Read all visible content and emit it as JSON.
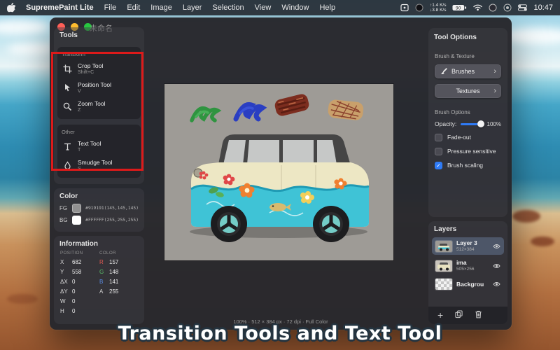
{
  "menubar": {
    "app_name": "SupremePaint Lite",
    "menus": [
      "File",
      "Edit",
      "Image",
      "Layer",
      "Selection",
      "View",
      "Window",
      "Help"
    ],
    "status": {
      "net_up": "↑1.4 K/s",
      "net_down": "↓3.8 K/s",
      "battery_level": "90",
      "time": "10:47"
    }
  },
  "window": {
    "title": "未命名",
    "tools": {
      "title": "Tools",
      "transform_label": "Transform",
      "other_label": "Other",
      "items": [
        {
          "name": "Crop Tool",
          "shortcut": "Shift+C"
        },
        {
          "name": "Position Tool",
          "shortcut": "V"
        },
        {
          "name": "Zoom Tool",
          "shortcut": "Z"
        },
        {
          "name": "Text Tool",
          "shortcut": "T"
        },
        {
          "name": "Smudge Tool",
          "shortcut": "S"
        }
      ]
    },
    "color": {
      "title": "Color",
      "fg_label": "FG",
      "fg_value": "#919191(145,145,145)",
      "fg_hex": "#919191",
      "bg_label": "BG",
      "bg_value": "#FFFFFF(255,255,255)",
      "bg_hex": "#FFFFFF"
    },
    "info": {
      "title": "Information",
      "position_header": "POSITION",
      "color_header": "COLOR",
      "rows": [
        {
          "pl": "X",
          "pv": "682",
          "cl": "R",
          "cv": "157"
        },
        {
          "pl": "Y",
          "pv": "558",
          "cl": "G",
          "cv": "148"
        },
        {
          "pl": "ΔX",
          "pv": "0",
          "cl": "B",
          "cv": "141"
        },
        {
          "pl": "ΔY",
          "pv": "0",
          "cl": "A",
          "cv": "255"
        },
        {
          "pl": "W",
          "pv": "0",
          "cl": "",
          "cv": ""
        },
        {
          "pl": "H",
          "pv": "0",
          "cl": "",
          "cv": ""
        }
      ]
    },
    "tool_options": {
      "title": "Tool Options",
      "brush_texture_label": "Brush & Texture",
      "brushes_button": "Brushes",
      "textures_button": "Textures",
      "brush_options_label": "Brush Options",
      "opacity_label": "Opacity:",
      "opacity_value": "100%",
      "checkboxes": [
        {
          "label": "Fade-out",
          "checked": false
        },
        {
          "label": "Pressure sensitive",
          "checked": false
        },
        {
          "label": "Brush scaling",
          "checked": true
        }
      ]
    },
    "layers": {
      "title": "Layers",
      "items": [
        {
          "name": "Layer 3",
          "size": "512×384"
        },
        {
          "name": "ima",
          "size": "505×256"
        },
        {
          "name": "Backgrou",
          "size": ""
        }
      ]
    },
    "statusbar": "100% · 512 × 384 px · 72 dpi · Full Color"
  },
  "caption": "Transition Tools and Text Tool",
  "icons": {
    "check": "✓",
    "chevron": "›",
    "plus": "+"
  },
  "colors": {
    "accent_blue": "#2f7bf6",
    "annotation_red": "#dd1a1a",
    "canvas_bg": "#9e9b96"
  }
}
